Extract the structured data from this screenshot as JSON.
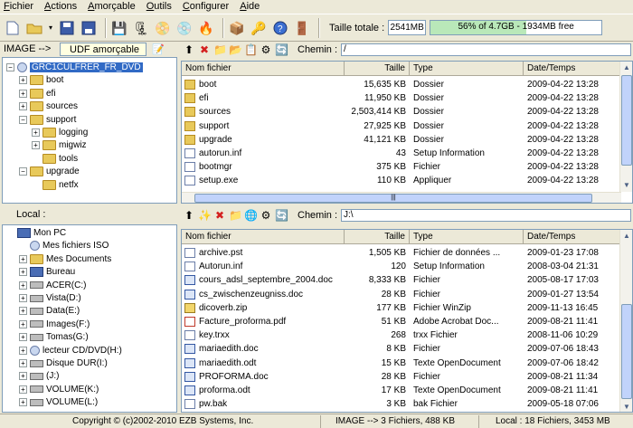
{
  "menu": [
    "Fichier",
    "Actions",
    "Amorçable",
    "Outils",
    "Configurer",
    "Aide"
  ],
  "toolbar": {
    "total_label": "Taille totale :",
    "total_value": "2541MB",
    "gauge_text": "56% of 4.7GB - 1934MB free",
    "gauge_fraction": 0.56
  },
  "image_mode": {
    "label": "IMAGE -->",
    "boot_type": "UDF amorçable"
  },
  "image_path": {
    "label": "Chemin :",
    "value": "/"
  },
  "image_tree": [
    {
      "label": "GRC1CULFRER_FR_DVD",
      "depth": 0,
      "expander": "-",
      "icon": "cd",
      "selected": true
    },
    {
      "label": "boot",
      "depth": 1,
      "expander": "+",
      "icon": "folder"
    },
    {
      "label": "efi",
      "depth": 1,
      "expander": "+",
      "icon": "folder"
    },
    {
      "label": "sources",
      "depth": 1,
      "expander": "+",
      "icon": "folder"
    },
    {
      "label": "support",
      "depth": 1,
      "expander": "-",
      "icon": "folder"
    },
    {
      "label": "logging",
      "depth": 2,
      "expander": "+",
      "icon": "folder"
    },
    {
      "label": "migwiz",
      "depth": 2,
      "expander": "+",
      "icon": "folder"
    },
    {
      "label": "tools",
      "depth": 2,
      "expander": "",
      "icon": "folder"
    },
    {
      "label": "upgrade",
      "depth": 1,
      "expander": "-",
      "icon": "folder"
    },
    {
      "label": "netfx",
      "depth": 2,
      "expander": "",
      "icon": "folder"
    }
  ],
  "columns": {
    "name": "Nom fichier",
    "size": "Taille",
    "type": "Type",
    "date": "Date/Temps"
  },
  "image_files": [
    {
      "name": "boot",
      "size": "15,635 KB",
      "type": "Dossier",
      "date": "2009-04-22 13:28",
      "icon": "folder"
    },
    {
      "name": "efi",
      "size": "11,950 KB",
      "type": "Dossier",
      "date": "2009-04-22 13:28",
      "icon": "folder"
    },
    {
      "name": "sources",
      "size": "2,503,414 KB",
      "type": "Dossier",
      "date": "2009-04-22 13:28",
      "icon": "folder"
    },
    {
      "name": "support",
      "size": "27,925 KB",
      "type": "Dossier",
      "date": "2009-04-22 13:28",
      "icon": "folder"
    },
    {
      "name": "upgrade",
      "size": "41,121 KB",
      "type": "Dossier",
      "date": "2009-04-22 13:28",
      "icon": "folder"
    },
    {
      "name": "autorun.inf",
      "size": "43",
      "type": "Setup Information",
      "date": "2009-04-22 13:28",
      "icon": "file"
    },
    {
      "name": "bootmgr",
      "size": "375 KB",
      "type": "Fichier",
      "date": "2009-04-22 13:28",
      "icon": "file"
    },
    {
      "name": "setup.exe",
      "size": "110 KB",
      "type": "Appliquer",
      "date": "2009-04-22 13:28",
      "icon": "file"
    }
  ],
  "local_label": "Local :",
  "local_path": {
    "label": "Chemin :",
    "value": "J:\\"
  },
  "local_tree": [
    {
      "label": "Mon PC",
      "depth": 0,
      "expander": "",
      "icon": "pc"
    },
    {
      "label": "Mes fichiers ISO",
      "depth": 1,
      "expander": "",
      "icon": "cd"
    },
    {
      "label": "Mes Documents",
      "depth": 1,
      "expander": "+",
      "icon": "folder"
    },
    {
      "label": "Bureau",
      "depth": 1,
      "expander": "+",
      "icon": "pc"
    },
    {
      "label": "ACER(C:)",
      "depth": 1,
      "expander": "+",
      "icon": "drive"
    },
    {
      "label": "Vista(D:)",
      "depth": 1,
      "expander": "+",
      "icon": "drive"
    },
    {
      "label": "Data(E:)",
      "depth": 1,
      "expander": "+",
      "icon": "drive"
    },
    {
      "label": "Images(F:)",
      "depth": 1,
      "expander": "+",
      "icon": "drive"
    },
    {
      "label": "Tomas(G:)",
      "depth": 1,
      "expander": "+",
      "icon": "drive"
    },
    {
      "label": "lecteur CD/DVD(H:)",
      "depth": 1,
      "expander": "+",
      "icon": "cd"
    },
    {
      "label": "Disque DUR(I:)",
      "depth": 1,
      "expander": "+",
      "icon": "drive"
    },
    {
      "label": "(J:)",
      "depth": 1,
      "expander": "+",
      "icon": "drive"
    },
    {
      "label": "VOLUME(K:)",
      "depth": 1,
      "expander": "+",
      "icon": "drive"
    },
    {
      "label": "VOLUME(L:)",
      "depth": 1,
      "expander": "+",
      "icon": "drive"
    }
  ],
  "local_files": [
    {
      "name": "archive.pst",
      "size": "1,505 KB",
      "type": "Fichier de données ...",
      "date": "2009-01-23 17:08",
      "icon": "file"
    },
    {
      "name": "Autorun.inf",
      "size": "120",
      "type": "Setup Information",
      "date": "2008-03-04 21:31",
      "icon": "file"
    },
    {
      "name": "cours_adsl_septembre_2004.doc",
      "size": "8,333 KB",
      "type": "Fichier",
      "date": "2005-08-17 17:03",
      "icon": "doc"
    },
    {
      "name": "cs_zwischenzeugniss.doc",
      "size": "28 KB",
      "type": "Fichier",
      "date": "2009-01-27 13:54",
      "icon": "doc"
    },
    {
      "name": "dicoverb.zip",
      "size": "177 KB",
      "type": "Fichier WinZip",
      "date": "2009-11-13 16:45",
      "icon": "zip"
    },
    {
      "name": "Facture_proforma.pdf",
      "size": "51 KB",
      "type": "Adobe Acrobat Doc...",
      "date": "2009-08-21 11:41",
      "icon": "pdf"
    },
    {
      "name": "key.trxx",
      "size": "268",
      "type": "trxx Fichier",
      "date": "2008-11-06 10:29",
      "icon": "file"
    },
    {
      "name": "mariaedith.doc",
      "size": "8 KB",
      "type": "Fichier",
      "date": "2009-07-06 18:43",
      "icon": "doc"
    },
    {
      "name": "mariaedith.odt",
      "size": "15 KB",
      "type": "Texte OpenDocument",
      "date": "2009-07-06 18:42",
      "icon": "doc"
    },
    {
      "name": "PROFORMA.doc",
      "size": "28 KB",
      "type": "Fichier",
      "date": "2009-08-21 11:34",
      "icon": "doc"
    },
    {
      "name": "proforma.odt",
      "size": "17 KB",
      "type": "Texte OpenDocument",
      "date": "2009-08-21 11:41",
      "icon": "doc"
    },
    {
      "name": "pw.bak",
      "size": "3 KB",
      "type": "bak Fichier",
      "date": "2009-05-18 07:06",
      "icon": "file"
    }
  ],
  "status": {
    "copyright": "Copyright © (c)2002-2010 EZB Systems, Inc.",
    "image_info": "IMAGE --> 3 Fichiers, 488 KB",
    "local_info": "Local : 18 Fichiers, 3453 MB"
  },
  "colors": {
    "selection": "#316ac5",
    "gauge_fill": "#b9e8b9",
    "tooltip": "#ffffe1"
  }
}
